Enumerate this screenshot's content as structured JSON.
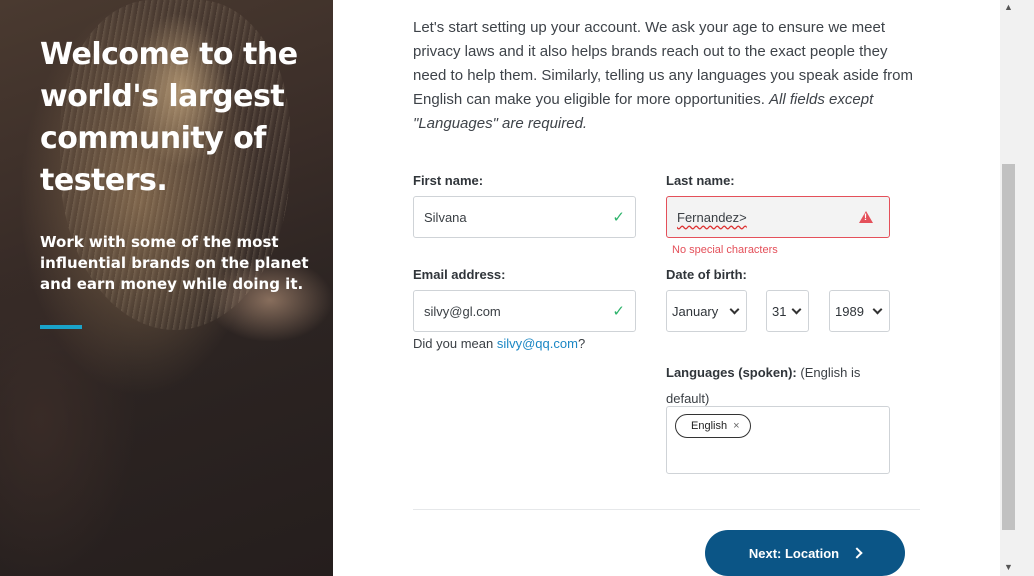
{
  "hero": {
    "title": "Welcome to the world's largest community of testers.",
    "subtitle": "Work with some of the most influential brands on the planet and earn money while doing it.",
    "accent_color": "#1aa3c9"
  },
  "intro": {
    "text": "Let's start setting up your account. We ask your age to ensure we meet privacy laws and it also helps brands reach out to the exact people they need to help them. Similarly, telling us any languages you speak aside from English can make you eligible for more opportunities. ",
    "emphasis": "All fields except \"Languages\" are required."
  },
  "form": {
    "first_name": {
      "label": "First name:",
      "value": "Silvana",
      "status": "valid"
    },
    "last_name": {
      "label": "Last name:",
      "value": "Fernandez>",
      "status": "error",
      "error": "No special characters"
    },
    "email": {
      "label": "Email address:",
      "value": "silvy@gl.com",
      "status": "valid",
      "suggestion_prefix": "Did you mean ",
      "suggestion": "silvy@qq.com",
      "suggestion_suffix": "?"
    },
    "dob": {
      "label": "Date of birth:",
      "month": "January",
      "day": "31",
      "year": "1989"
    },
    "languages": {
      "label": "Languages (spoken):",
      "hint": " (English is default)",
      "tags": [
        {
          "label": "English",
          "remove": "×"
        }
      ]
    }
  },
  "actions": {
    "next_label": "Next: Location",
    "button_color": "#0b5586"
  },
  "icons": {
    "valid": "checkmark-icon",
    "error": "warning-icon"
  },
  "colors": {
    "valid": "#2db36b",
    "error": "#e4505a",
    "link": "#1b87c4"
  }
}
